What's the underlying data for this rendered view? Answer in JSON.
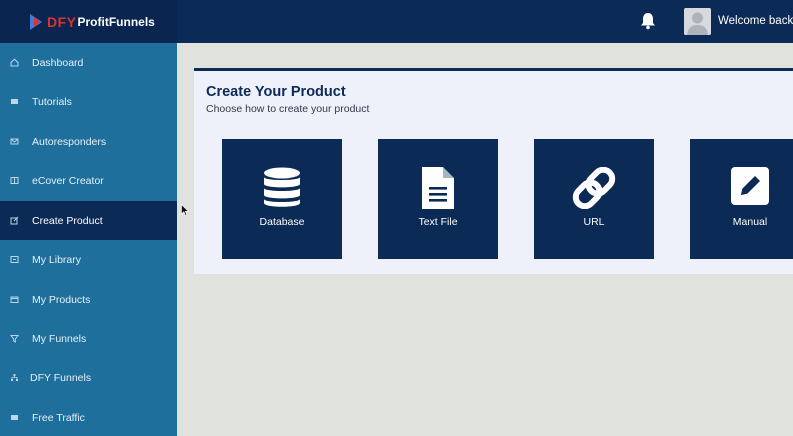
{
  "brand": {
    "logo_dfy": "DFY",
    "logo_rest": "ProfitFunnels"
  },
  "header": {
    "welcome": "Welcome back,"
  },
  "sidebar": {
    "items": [
      {
        "label": "Dashboard",
        "icon": "home-icon",
        "active": false
      },
      {
        "label": "Tutorials",
        "icon": "list-icon",
        "active": false
      },
      {
        "label": "Autoresponders",
        "icon": "envelope-icon",
        "active": false
      },
      {
        "label": "eCover Creator",
        "icon": "book-icon",
        "active": false
      },
      {
        "label": "Create Product",
        "icon": "edit-icon",
        "active": true
      },
      {
        "label": "My Library",
        "icon": "library-icon",
        "active": false
      },
      {
        "label": "My Products",
        "icon": "box-icon",
        "active": false
      },
      {
        "label": "My Funnels",
        "icon": "filter-icon",
        "active": false
      },
      {
        "label": "DFY Funnels",
        "icon": "sitemap-icon",
        "active": false
      },
      {
        "label": "Free Traffic",
        "icon": "list-icon",
        "active": false
      }
    ]
  },
  "main": {
    "title": "Create Your Product",
    "subtitle": "Choose how to create your product",
    "options": [
      {
        "label": "Database",
        "icon": "database-icon"
      },
      {
        "label": "Text File",
        "icon": "file-text-icon"
      },
      {
        "label": "URL",
        "icon": "link-icon"
      },
      {
        "label": "Manual",
        "icon": "pencil-square-icon"
      }
    ]
  },
  "colors": {
    "navy": "#0b2a55",
    "sidebar": "#1e6f9c",
    "card": "#eef0fa",
    "page": "#dfe2dd",
    "logo_red": "#e0302f"
  }
}
